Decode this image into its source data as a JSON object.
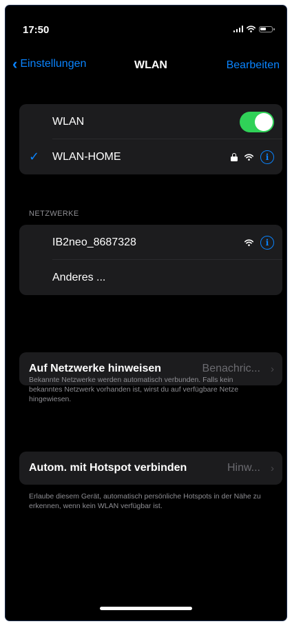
{
  "status_bar": {
    "time": "17:50"
  },
  "nav": {
    "back_label": "Einstellungen",
    "title": "WLAN",
    "edit_label": "Bearbeiten"
  },
  "wlan_group": {
    "toggle_label": "WLAN",
    "toggle_on": true,
    "connected_network": "WLAN-HOME"
  },
  "networks": {
    "header": "NETZWERKE",
    "items": [
      {
        "name": "IB2neo_8687328"
      },
      {
        "name": "Anderes ..."
      }
    ]
  },
  "notify_setting": {
    "label": "Auf Netzwerke hinweisen",
    "value": "Benachric...",
    "footnote": "Bekannte Netzwerke werden automatisch verbunden. Falls kein bekanntes Netzwerk vorhanden ist, wirst du auf verfügbare Netze hingewiesen."
  },
  "hotspot_setting": {
    "label": "Autom. mit Hotspot verbinden",
    "value": "Hinw...",
    "footnote": "Erlaube diesem Gerät, automatisch persönliche Hotspots in der Nähe zu erkennen, wenn kein WLAN verfügbar ist."
  },
  "colors": {
    "accent": "#0a84ff",
    "toggle_on": "#30d158",
    "cell_background": "#1c1c1e",
    "secondary_text": "#8e8e93"
  },
  "icons": [
    "signal-icon",
    "wifi-icon",
    "battery-icon",
    "chevron-left-icon",
    "checkmark-icon",
    "lock-icon",
    "info-icon",
    "chevron-right-icon"
  ]
}
